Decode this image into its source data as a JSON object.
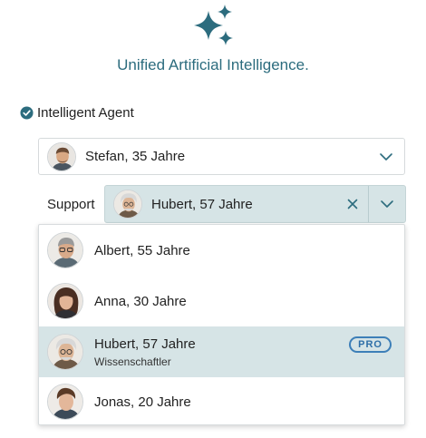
{
  "brand": {
    "icon": "sparkle-icon",
    "title": "Unified Artificial Intelligence.",
    "accent_color": "#2c6c7e"
  },
  "agent": {
    "checked": true,
    "label": "Intelligent Agent"
  },
  "primary_select": {
    "selected": "Stefan, 35 Jahre",
    "avatar": "avatar-stefan"
  },
  "support": {
    "label": "Support",
    "selected": "Hubert, 57 Jahre",
    "avatar": "avatar-hubert",
    "clear_icon": "close-icon",
    "toggle_icon": "chevron-down-icon",
    "highlight_color": "#d6e4e6"
  },
  "dropdown": {
    "options": [
      {
        "name": "Albert, 55 Jahre",
        "subtitle": "",
        "badge": "",
        "selected": false
      },
      {
        "name": "Anna, 30 Jahre",
        "subtitle": "",
        "badge": "",
        "selected": false
      },
      {
        "name": "Hubert, 57 Jahre",
        "subtitle": "Wissenschaftler",
        "badge": "PRO",
        "selected": true
      },
      {
        "name": "Jonas, 20 Jahre",
        "subtitle": "",
        "badge": "",
        "selected": false
      }
    ]
  }
}
